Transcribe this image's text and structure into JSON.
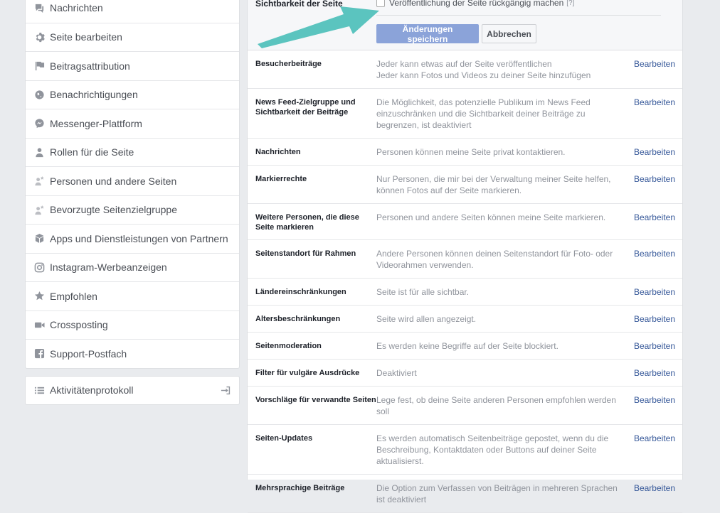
{
  "sidebar": {
    "items": [
      {
        "label": "Nachrichten",
        "icon": "messages-icon"
      },
      {
        "label": "Seite bearbeiten",
        "icon": "gear-icon"
      },
      {
        "label": "Beitragsattribution",
        "icon": "flag-icon"
      },
      {
        "label": "Benachrichtigungen",
        "icon": "globe-icon"
      },
      {
        "label": "Messenger-Plattform",
        "icon": "messenger-icon"
      },
      {
        "label": "Rollen für die Seite",
        "icon": "person-icon"
      },
      {
        "label": "Personen und andere Seiten",
        "icon": "person-star-icon"
      },
      {
        "label": "Bevorzugte Seitenzielgruppe",
        "icon": "person-star-icon"
      },
      {
        "label": "Apps und Dienstleistungen von Partnern",
        "icon": "cube-icon"
      },
      {
        "label": "Instagram-Werbeanzeigen",
        "icon": "instagram-icon"
      },
      {
        "label": "Empfohlen",
        "icon": "star-icon"
      },
      {
        "label": "Crossposting",
        "icon": "video-icon"
      },
      {
        "label": "Support-Postfach",
        "icon": "facebook-icon"
      }
    ],
    "activity": {
      "label": "Aktivitätenprotokoll",
      "icon": "list-icon",
      "exit_icon": "exit-icon"
    }
  },
  "edit": {
    "label": "Sichtbarkeit der Seite",
    "checkbox_label": "Veröffentlichung der Seite rückgängig machen",
    "help": "[?]",
    "save": "Änderungen speichern",
    "cancel": "Abbrechen",
    "arrow_color": "#5bc4bf"
  },
  "settings": {
    "edit_label": "Bearbeiten",
    "rows": [
      {
        "label": "Besucherbeiträge",
        "value": "Jeder kann etwas auf der Seite veröffentlichen",
        "value2": "Jeder kann Fotos und Videos zu deiner Seite hinzufügen"
      },
      {
        "label": "News Feed-Zielgruppe und Sichtbarkeit der Beiträge",
        "value": "Die Möglichkeit, das potenzielle Publikum im News Feed einzuschränken und die Sichtbarkeit deiner Beiträge zu begrenzen, ist deaktiviert",
        "value2": ""
      },
      {
        "label": "Nachrichten",
        "value": "Personen können meine Seite privat kontaktieren.",
        "value2": ""
      },
      {
        "label": "Markierrechte",
        "value": "Nur Personen, die mir bei der Verwaltung meiner Seite helfen, können Fotos auf der Seite markieren.",
        "value2": ""
      },
      {
        "label": "Weitere Personen, die diese Seite markieren",
        "value": "Personen und andere Seiten können meine Seite markieren.",
        "value2": ""
      },
      {
        "label": "Seitenstandort für Rahmen",
        "value": "Andere Personen können deinen Seitenstandort für Foto- oder Videorahmen verwenden.",
        "value2": ""
      },
      {
        "label": "Ländereinschränkungen",
        "value": "Seite ist für alle sichtbar.",
        "value2": ""
      },
      {
        "label": "Altersbeschränkungen",
        "value": "Seite wird allen angezeigt.",
        "value2": ""
      },
      {
        "label": "Seitenmoderation",
        "value": "Es werden keine Begriffe auf der Seite blockiert.",
        "value2": ""
      },
      {
        "label": "Filter für vulgäre Ausdrücke",
        "value": "Deaktiviert",
        "value2": ""
      },
      {
        "label": "Vorschläge für verwandte Seiten",
        "value": "Lege fest, ob deine Seite anderen Personen empfohlen werden soll",
        "value2": ""
      },
      {
        "label": "Seiten-Updates",
        "value": "Es werden automatisch Seitenbeiträge gepostet, wenn du die Beschreibung, Kontaktdaten oder Buttons auf deiner Seite aktualisierst.",
        "value2": ""
      },
      {
        "label": "Mehrsprachige Beiträge",
        "value": "Die Option zum Verfassen von Beiträgen in mehreren Sprachen ist deaktiviert",
        "value2": ""
      }
    ]
  }
}
